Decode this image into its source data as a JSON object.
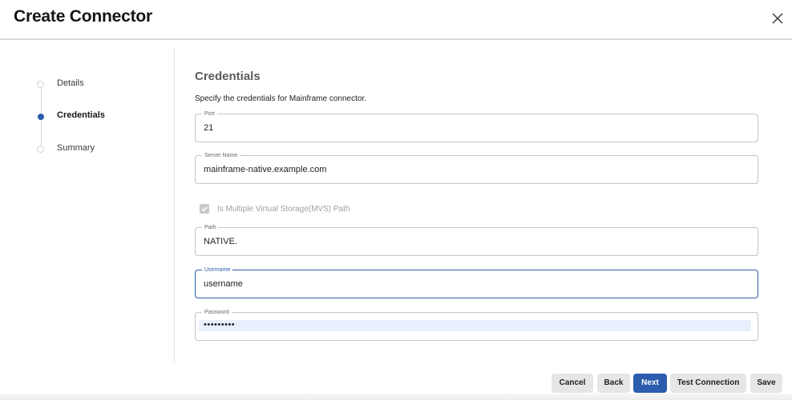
{
  "header": {
    "title": "Create Connector",
    "close_icon": "close-icon"
  },
  "stepper": {
    "steps": [
      {
        "label": "Details",
        "state": "pending"
      },
      {
        "label": "Credentials",
        "state": "active"
      },
      {
        "label": "Summary",
        "state": "pending"
      }
    ]
  },
  "section": {
    "title": "Credentials",
    "description": "Specify the credentials for Mainframe connector."
  },
  "fields": {
    "port": {
      "label": "Port",
      "value": "21"
    },
    "server_name": {
      "label": "Server Name",
      "value": "mainframe-native.example.com"
    },
    "mvs_checkbox": {
      "label": "Is Multiple Virtual Storage(MVS) Path",
      "checked": true,
      "disabled": true
    },
    "path": {
      "label": "Path",
      "value": "NATIVE."
    },
    "username": {
      "label": "Username",
      "value": "username"
    },
    "password": {
      "label": "Password",
      "value": "•••••••••"
    }
  },
  "buttons": {
    "cancel": "Cancel",
    "back": "Back",
    "next": "Next",
    "test_connection": "Test Connection",
    "save": "Save"
  },
  "colors": {
    "accent": "#2b5cad",
    "autofill_bg": "#e8f0fe",
    "border": "#c4c4c4"
  }
}
